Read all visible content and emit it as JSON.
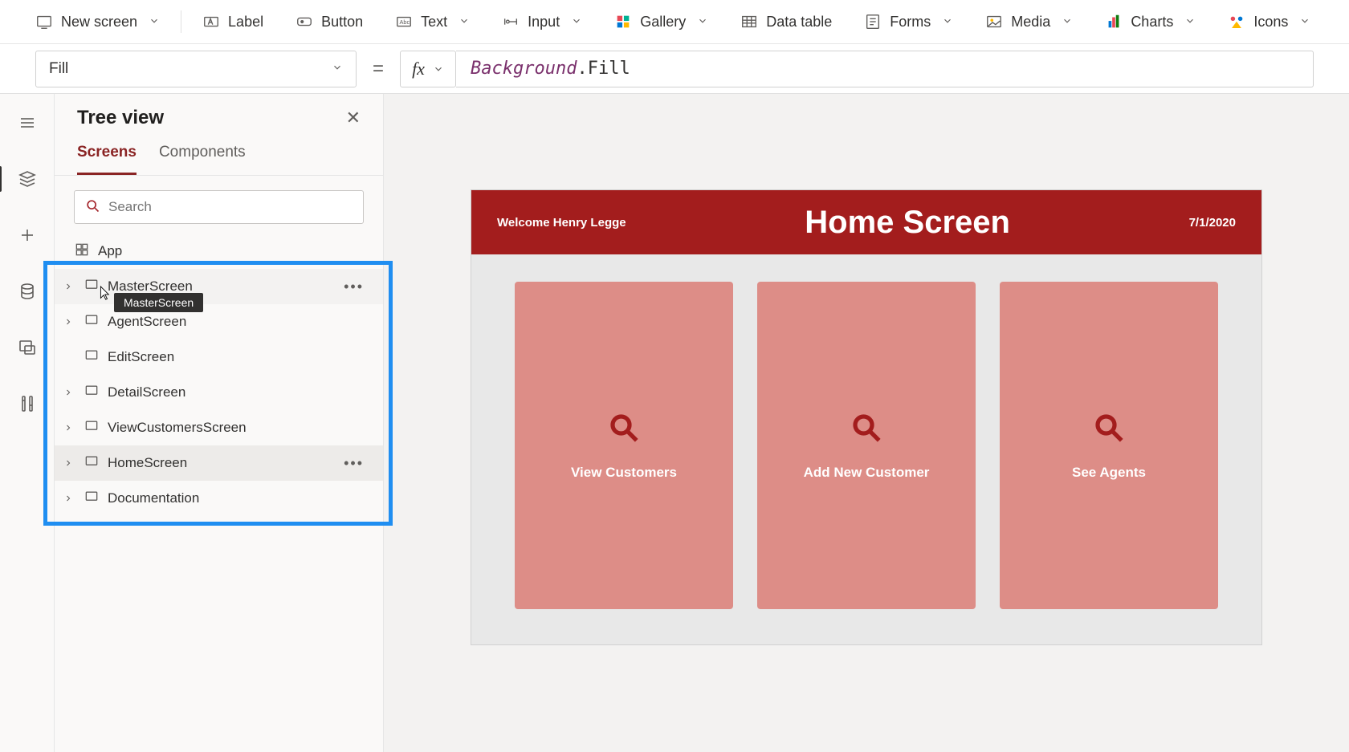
{
  "ribbon": {
    "new_screen": "New screen",
    "label": "Label",
    "button": "Button",
    "text": "Text",
    "input": "Input",
    "gallery": "Gallery",
    "data_table": "Data table",
    "forms": "Forms",
    "media": "Media",
    "charts": "Charts",
    "icons": "Icons"
  },
  "formula": {
    "property": "Fill",
    "fx": "fx",
    "object": "Background",
    "dot": ".",
    "prop": "Fill"
  },
  "tree": {
    "title": "Tree view",
    "tabs": {
      "screens": "Screens",
      "components": "Components"
    },
    "search_placeholder": "Search",
    "app": "App",
    "items": [
      {
        "name": "MasterScreen"
      },
      {
        "name": "AgentScreen"
      },
      {
        "name": "EditScreen"
      },
      {
        "name": "DetailScreen"
      },
      {
        "name": "ViewCustomersScreen"
      },
      {
        "name": "HomeScreen"
      },
      {
        "name": "Documentation"
      }
    ],
    "tooltip": "MasterScreen"
  },
  "app": {
    "welcome": "Welcome Henry Legge",
    "title": "Home Screen",
    "date": "7/1/2020",
    "tiles": [
      {
        "label": "View Customers"
      },
      {
        "label": "Add New Customer"
      },
      {
        "label": "See Agents"
      }
    ]
  }
}
